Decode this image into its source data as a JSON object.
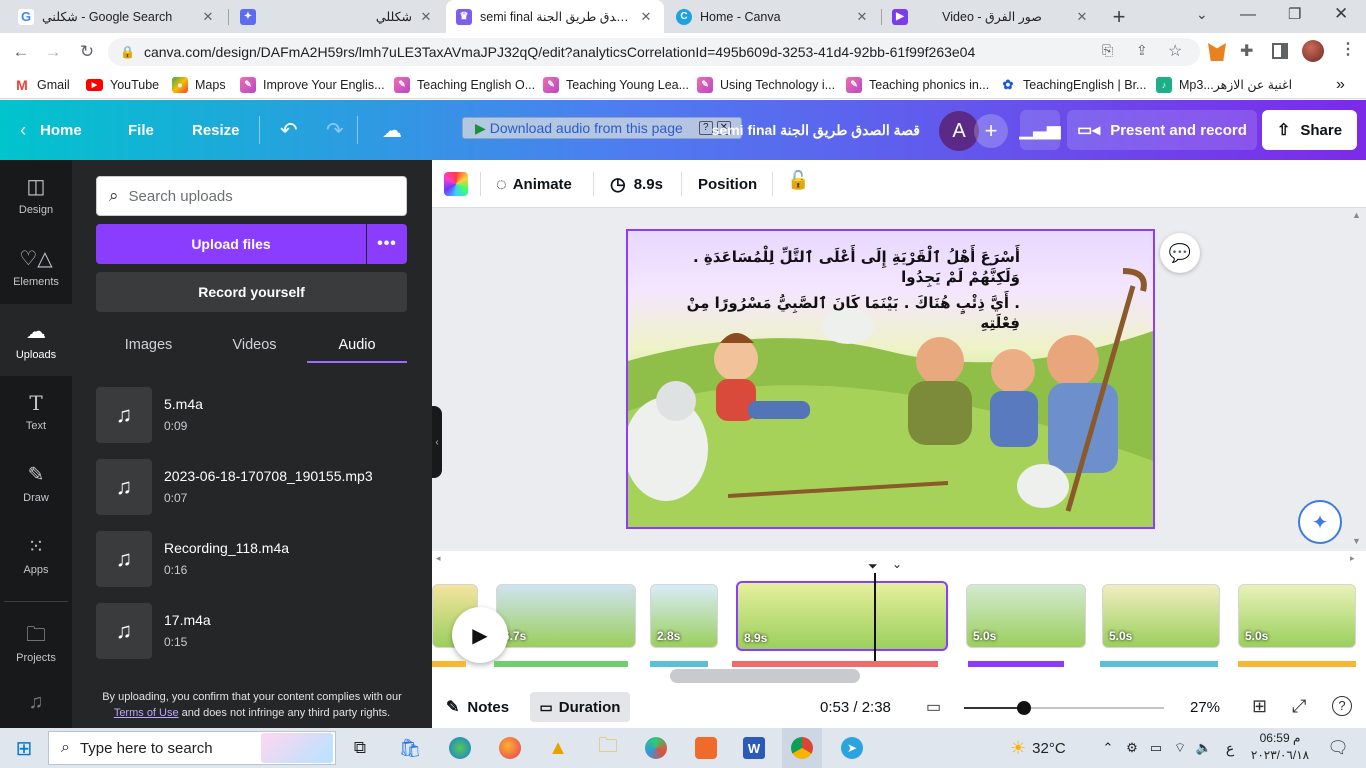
{
  "browser": {
    "tabs": [
      {
        "title": "شكلني - Google Search",
        "icon": "google-icon",
        "active": false
      },
      {
        "title": "شكللي",
        "icon": "canva-fav-icon",
        "active": false
      },
      {
        "title": "semi final قصة الصدق طريق الجنة",
        "icon": "canva-design-icon",
        "active": true
      },
      {
        "title": "Home - Canva",
        "icon": "canva-icon",
        "active": false
      },
      {
        "title": "Video - صور الفرق",
        "icon": "video-icon",
        "active": false
      }
    ],
    "new_tab_label": "+",
    "url": "canva.com/design/DAFmA2H59rs/lmh7uLE3TaxAVmaJPJ32qQ/edit?analyticsCorrelationId=495b609d-3253-41d4-92bb-61f99f263e04",
    "bookmarks": [
      {
        "label": "Gmail",
        "icon": "gmail-icon"
      },
      {
        "label": "YouTube",
        "icon": "youtube-icon"
      },
      {
        "label": "Maps",
        "icon": "maps-icon"
      },
      {
        "label": "Improve Your Englis...",
        "icon": "bookmark-icon"
      },
      {
        "label": "Teaching English O...",
        "icon": "bookmark-icon"
      },
      {
        "label": "Teaching Young Lea...",
        "icon": "bookmark-icon"
      },
      {
        "label": "Using Technology i...",
        "icon": "bookmark-icon"
      },
      {
        "label": "Teaching phonics in...",
        "icon": "bookmark-icon"
      },
      {
        "label": "TeachingEnglish | Br...",
        "icon": "teachingenglish-icon"
      },
      {
        "label": "Mp3...اغنية عن الازهر",
        "icon": "mp3-icon"
      }
    ],
    "bookmarks_more": "»"
  },
  "canva_top": {
    "home": "Home",
    "file": "File",
    "resize": "Resize",
    "download_audio": "Download audio from this page",
    "doc_title": "semi final قصة الصدق طريق الجنة",
    "avatar_letter": "A",
    "present": "Present and record",
    "share": "Share"
  },
  "rail": [
    {
      "label": "Design",
      "icon": "design-icon"
    },
    {
      "label": "Elements",
      "icon": "elements-icon"
    },
    {
      "label": "Uploads",
      "icon": "uploads-icon"
    },
    {
      "label": "Text",
      "icon": "text-icon"
    },
    {
      "label": "Draw",
      "icon": "draw-icon"
    },
    {
      "label": "Apps",
      "icon": "apps-icon"
    },
    {
      "label": "Projects",
      "icon": "projects-icon"
    }
  ],
  "panel": {
    "search_placeholder": "Search uploads",
    "upload_btn": "Upload files",
    "record_btn": "Record yourself",
    "tabs": [
      "Images",
      "Videos",
      "Audio"
    ],
    "active_tab": "Audio",
    "audio_items": [
      {
        "name": "5.m4a",
        "duration": "0:09"
      },
      {
        "name": "2023-06-18-170708_190155.mp3",
        "duration": "0:07"
      },
      {
        "name": "Recording_118.m4a",
        "duration": "0:16"
      },
      {
        "name": "17.m4a",
        "duration": "0:15"
      }
    ],
    "footer_text_1": "By uploading, you confirm that your content complies with our",
    "footer_link": "Terms of Use",
    "footer_text_2": " and does not infringe any third party rights."
  },
  "ctx": {
    "animate": "Animate",
    "time": "8.9s",
    "position": "Position"
  },
  "slide": {
    "line1": "أَسْرَعَ أَهْلُ ٱلْقَرْيَةِ إِلَى أَعْلَى ٱلتَّلِّ لِلْمُسَاعَدَةِ . وَلَكِنَّهُمْ لَمْ يَجِدُوا",
    "line2": ". أَيَّ ذِئْبٍ هُنَاكَ . بَيْنَمَا كَانَ ٱلصَّبِيُّ مَسْرُورًا مِنْ فِعْلَتِهِ"
  },
  "timeline": {
    "thumbs": [
      {
        "dur": "",
        "color": "#f4e4a0"
      },
      {
        "dur": "6.7s",
        "color": "#cfe3f0"
      },
      {
        "dur": "2.8s",
        "color": "#d9ecf7"
      },
      {
        "dur": "8.9s",
        "color": "#e6ef9c"
      },
      {
        "dur": "5.0s",
        "color": "#d3ead0"
      },
      {
        "dur": "5.0s",
        "color": "#f1eec0"
      },
      {
        "dur": "5.0s",
        "color": "#e9f2b8"
      }
    ]
  },
  "bottom": {
    "notes": "Notes",
    "duration": "Duration",
    "time": "0:53 / 2:38",
    "zoom_level": 0.3,
    "zoom": "27%"
  },
  "taskbar": {
    "search_placeholder": "Type here to search",
    "temp": "32°C",
    "clock_time": "06:59 م",
    "clock_date": "٢٠٢٣/٠٦/١٨",
    "lang": "ع"
  }
}
